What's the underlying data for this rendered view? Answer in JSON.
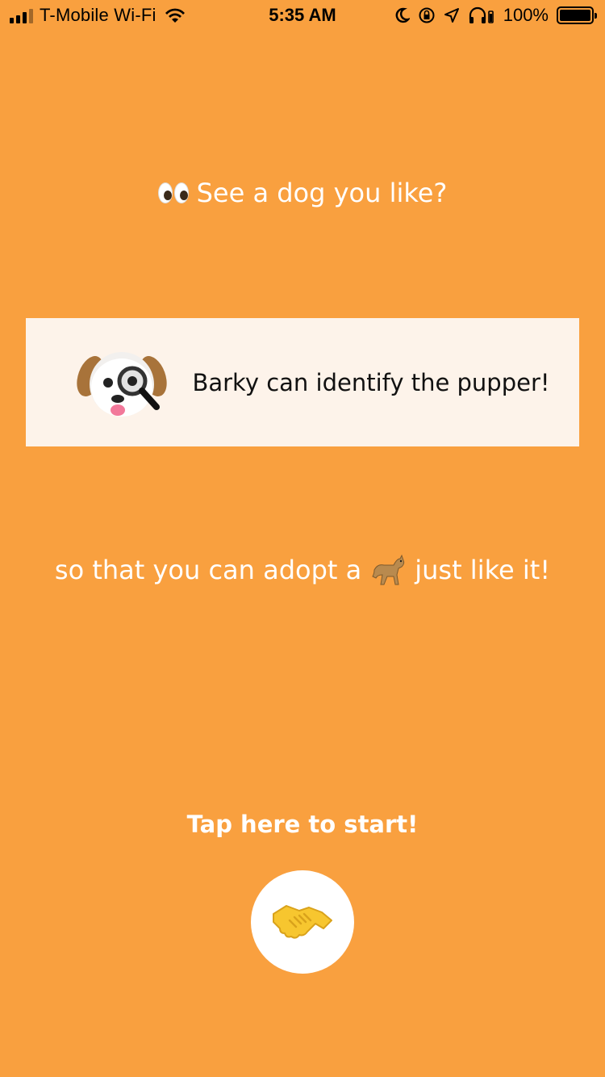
{
  "status_bar": {
    "carrier": "T-Mobile Wi-Fi",
    "time": "5:35 AM",
    "battery_percent": "100%",
    "battery_level": 1.0,
    "icons": [
      "signal-icon",
      "wifi-icon",
      "moon-icon",
      "orientation-lock-icon",
      "location-icon",
      "headphones-icon",
      "battery-icon"
    ]
  },
  "headline": {
    "emoji_icon": "eyes-icon",
    "text": "See a dog you like?"
  },
  "card": {
    "icon": "dog-magnifier-icon",
    "text": "Barky can identify the pupper!",
    "background": "#FDF3EA"
  },
  "subline": {
    "text_before": "so that you can adopt a",
    "icon": "dog-icon",
    "text_after": "just like it!"
  },
  "cta": {
    "label": "Tap here to start!",
    "button_icon": "handshake-icon"
  },
  "colors": {
    "background": "#F9A03F",
    "text": "#FFFFFF",
    "card_text": "#111111",
    "button": "#FFFFFF"
  }
}
